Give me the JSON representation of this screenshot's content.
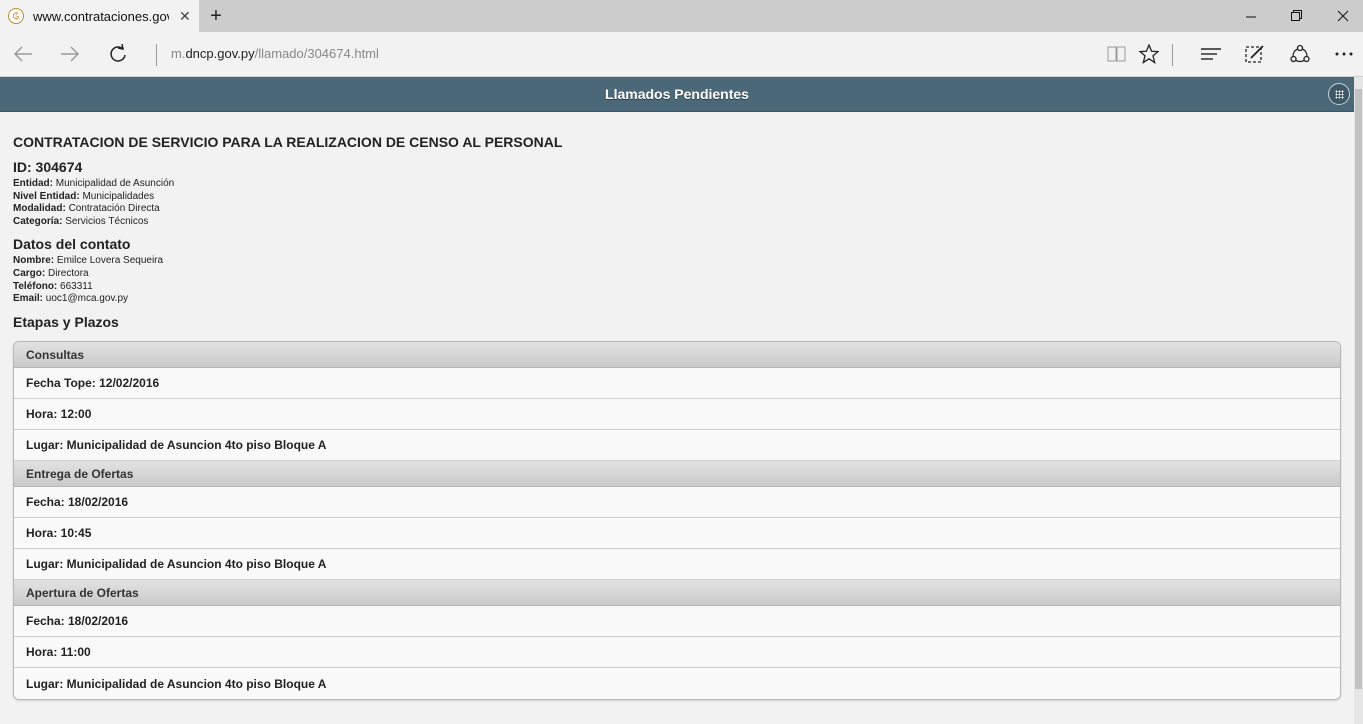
{
  "browser": {
    "tab_title": "www.contrataciones.gov",
    "favicon": "₲",
    "address_prefix": "m.",
    "address_host": "dncp.gov.py",
    "address_path": "/llamado/304674.html"
  },
  "header": {
    "title": "Llamados Pendientes"
  },
  "details": {
    "title": "CONTRATACION DE SERVICIO PARA LA REALIZACION DE CENSO AL PERSONAL",
    "id_line": "ID: 304674",
    "entidad_label": "Entidad:",
    "entidad_value": "Municipalidad de Asunción",
    "nivel_label": "Nivel Entidad:",
    "nivel_value": "Municipalidades",
    "modalidad_label": "Modalidad:",
    "modalidad_value": "Contratación Directa",
    "categoria_label": "Categoría:",
    "categoria_value": "Servicios Técnicos"
  },
  "contact": {
    "heading": "Datos del contato",
    "nombre_label": "Nombre:",
    "nombre_value": "Emilce Lovera Sequeira",
    "cargo_label": "Cargo:",
    "cargo_value": "Directora",
    "telefono_label": "Teléfono:",
    "telefono_value": "663311",
    "email_label": "Email:",
    "email_value": "uoc1@mca.gov.py"
  },
  "stages": {
    "heading": "Etapas y Plazos",
    "consultas": {
      "label": "Consultas",
      "fecha": "Fecha Tope: 12/02/2016",
      "hora": "Hora: 12:00",
      "lugar": "Lugar: Municipalidad de Asuncion 4to piso Bloque A"
    },
    "entrega": {
      "label": "Entrega de Ofertas",
      "fecha": "Fecha: 18/02/2016",
      "hora": "Hora: 10:45",
      "lugar": "Lugar: Municipalidad de Asuncion 4to piso Bloque A"
    },
    "apertura": {
      "label": "Apertura de Ofertas",
      "fecha": "Fecha: 18/02/2016",
      "hora": "Hora: 11:00",
      "lugar": "Lugar: Municipalidad de Asuncion 4to piso Bloque A"
    }
  },
  "icons": {
    "tab_close": "close-icon",
    "new_tab": "plus-icon",
    "back": "back-arrow-icon",
    "forward": "forward-arrow-icon",
    "refresh": "refresh-icon",
    "reading_view": "book-icon",
    "favorite": "star-icon",
    "hub": "hub-icon",
    "web_note": "pen-icon",
    "share": "share-icon",
    "more": "more-icon",
    "grid": "grid-icon"
  },
  "colors": {
    "header_bg": "#4a6877",
    "page_bg": "#f2f2f2"
  }
}
